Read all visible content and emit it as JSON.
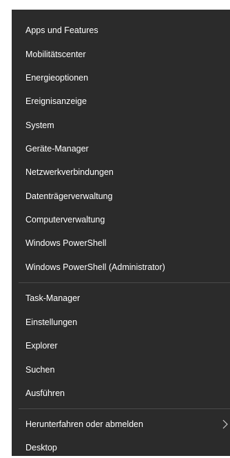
{
  "menu": {
    "group1": [
      {
        "label": "Apps und Features"
      },
      {
        "label": "Mobilitätscenter"
      },
      {
        "label": "Energieoptionen"
      },
      {
        "label": "Ereignisanzeige"
      },
      {
        "label": "System"
      },
      {
        "label": "Geräte-Manager"
      },
      {
        "label": "Netzwerkverbindungen"
      },
      {
        "label": "Datenträgerverwaltung"
      },
      {
        "label": "Computerverwaltung"
      },
      {
        "label": "Windows PowerShell"
      },
      {
        "label": "Windows PowerShell (Administrator)"
      }
    ],
    "group2": [
      {
        "label": "Task-Manager"
      },
      {
        "label": "Einstellungen"
      },
      {
        "label": "Explorer"
      },
      {
        "label": "Suchen"
      },
      {
        "label": "Ausführen"
      }
    ],
    "group3": [
      {
        "label": "Herunterfahren oder abmelden",
        "submenu_icon": "chevron-right-icon"
      },
      {
        "label": "Desktop"
      }
    ]
  },
  "colors": {
    "menu_background": "#2b2b2b",
    "text": "#ffffff",
    "separator": "#4a4a4a",
    "page_background": "#ffffff"
  }
}
